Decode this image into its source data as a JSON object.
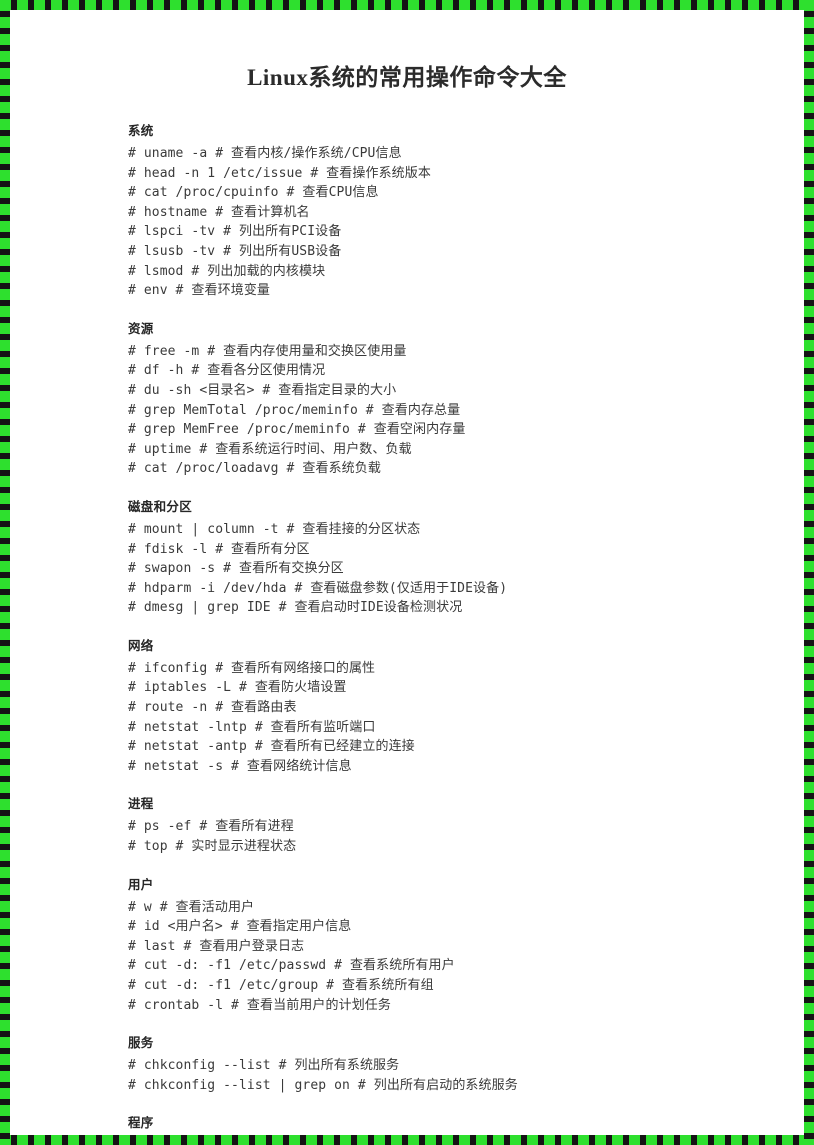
{
  "document": {
    "title": "Linux系统的常用操作命令大全",
    "border_color": "#2ee02e",
    "background_color": "#ffffff",
    "text_color": "#3a3a3a"
  },
  "sections": [
    {
      "heading": "系统",
      "commands": [
        "# uname -a # 查看内核/操作系统/CPU信息",
        "# head -n 1 /etc/issue # 查看操作系统版本",
        "# cat /proc/cpuinfo # 查看CPU信息",
        "# hostname # 查看计算机名",
        "# lspci -tv # 列出所有PCI设备",
        "# lsusb -tv # 列出所有USB设备",
        "# lsmod # 列出加载的内核模块",
        "# env # 查看环境变量"
      ]
    },
    {
      "heading": "资源",
      "commands": [
        "# free -m # 查看内存使用量和交换区使用量",
        "# df -h # 查看各分区使用情况",
        "# du -sh <目录名> # 查看指定目录的大小",
        "# grep MemTotal /proc/meminfo # 查看内存总量",
        "# grep MemFree /proc/meminfo # 查看空闲内存量",
        "# uptime # 查看系统运行时间、用户数、负载",
        "# cat /proc/loadavg # 查看系统负载"
      ]
    },
    {
      "heading": "磁盘和分区",
      "commands": [
        "# mount | column -t # 查看挂接的分区状态",
        "# fdisk -l # 查看所有分区",
        "# swapon -s # 查看所有交换分区",
        "# hdparm -i /dev/hda # 查看磁盘参数(仅适用于IDE设备)",
        "# dmesg | grep IDE # 查看启动时IDE设备检测状况"
      ]
    },
    {
      "heading": "网络",
      "commands": [
        "# ifconfig # 查看所有网络接口的属性",
        "# iptables -L # 查看防火墙设置",
        "# route -n # 查看路由表",
        "# netstat -lntp # 查看所有监听端口",
        "# netstat -antp # 查看所有已经建立的连接",
        "# netstat -s # 查看网络统计信息"
      ]
    },
    {
      "heading": "进程",
      "commands": [
        "# ps -ef # 查看所有进程",
        "# top # 实时显示进程状态"
      ]
    },
    {
      "heading": "用户",
      "commands": [
        "# w # 查看活动用户",
        "# id <用户名> # 查看指定用户信息",
        "# last # 查看用户登录日志",
        "# cut -d: -f1 /etc/passwd # 查看系统所有用户",
        "# cut -d: -f1 /etc/group # 查看系统所有组",
        "# crontab -l # 查看当前用户的计划任务"
      ]
    },
    {
      "heading": "服务",
      "commands": [
        "# chkconfig --list # 列出所有系统服务",
        "# chkconfig --list | grep on # 列出所有启动的系统服务"
      ]
    },
    {
      "heading": "程序",
      "commands": []
    }
  ]
}
